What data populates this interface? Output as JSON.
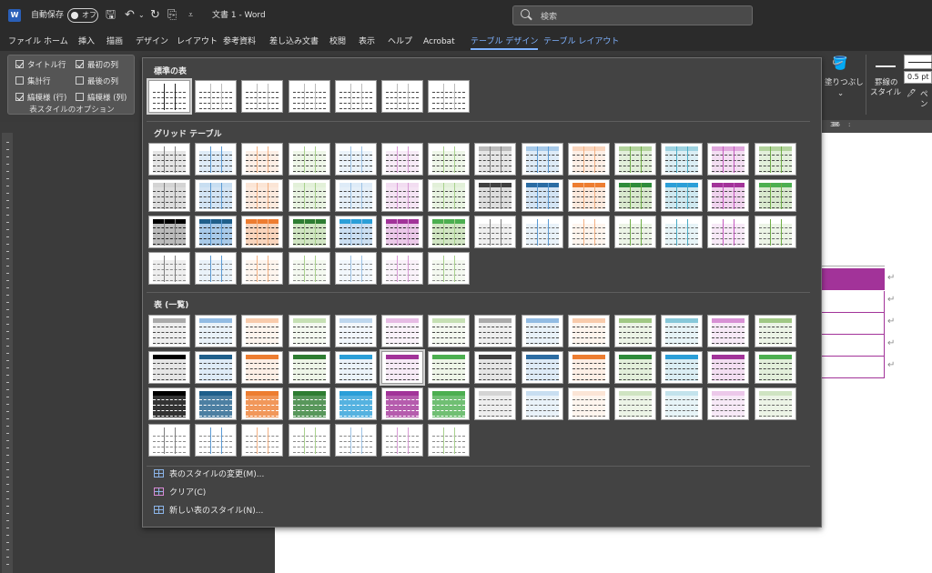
{
  "titlebar": {
    "autosave_label": "自動保存",
    "autosave_state": "オフ",
    "doc_title": "文書 1 - Word",
    "search_placeholder": "検索"
  },
  "menu": {
    "items": [
      "ファイル",
      "ホーム",
      "挿入",
      "描画",
      "デザイン",
      "レイアウト",
      "参考資料",
      "差し込み文書",
      "校閲",
      "表示",
      "ヘルプ",
      "Acrobat",
      "テーブル デザイン",
      "テーブル レイアウト"
    ],
    "active_index": 12
  },
  "ribbon": {
    "options": {
      "title_row": "タイトル行",
      "first_col": "最初の列",
      "total_row": "集計行",
      "last_col": "最後の列",
      "banded_rows": "縞模様 (行)",
      "banded_cols": "縞模様 (列)",
      "group_label": "表スタイルのオプション"
    },
    "shading_label": "塗りつぶし",
    "border_style_label1": "罫線の",
    "border_style_label2": "スタイル",
    "pen_width": "0.5 pt",
    "pen_label": "ペン",
    "ruler_36": "36"
  },
  "gallery": {
    "section_plain": "標準の表",
    "section_grid": "グリッド テーブル",
    "section_list": "表 (一覧)",
    "footer": {
      "modify": "表のスタイルの変更(M)...",
      "clear": "クリア(C)",
      "new": "新しい表のスタイル(N)..."
    }
  },
  "colors": {
    "palette": [
      "#7f7f7f",
      "#5b9bd5",
      "#f4b183",
      "#a9d18e",
      "#9dc3e6",
      "#d99ad6",
      "#a9d18e",
      "#7f7f7f",
      "#5b9bd5",
      "#f4b183",
      "#70ad47",
      "#4bacc6",
      "#c55ac0",
      "#70ad47"
    ],
    "dark": [
      "#000000",
      "#1f5f8b",
      "#ed7d31",
      "#2e7d32",
      "#2b9fd8",
      "#a23399",
      "#4caf50",
      "#404040",
      "#2b6ca3",
      "#ed7d31",
      "#2e8b3a",
      "#2b9fd8",
      "#a23399",
      "#4caf50"
    ],
    "doc_accent": "#a23399"
  }
}
